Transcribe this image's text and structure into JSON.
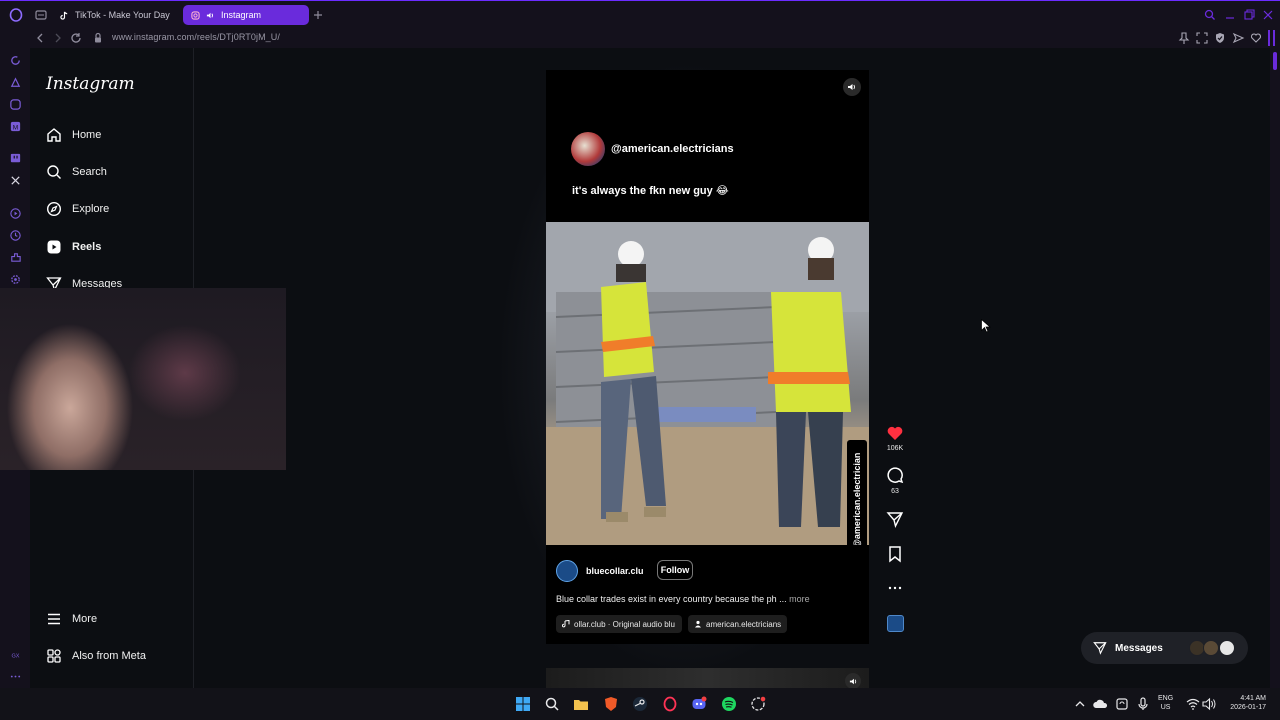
{
  "browser": {
    "tabs": [
      {
        "label": "TikTok - Make Your Day",
        "active": false
      },
      {
        "label": "Instagram",
        "active": true
      }
    ],
    "url": "www.instagram.com/reels/DTj0RT0jM_U/",
    "accent": "#6a2bdc"
  },
  "instagram": {
    "logo": "Instagram",
    "nav": [
      {
        "label": "Home",
        "icon": "home-icon"
      },
      {
        "label": "Search",
        "icon": "search-icon"
      },
      {
        "label": "Explore",
        "icon": "explore-icon"
      },
      {
        "label": "Reels",
        "icon": "reels-icon"
      },
      {
        "label": "Messages",
        "icon": "messages-icon"
      }
    ],
    "nav_bottom": [
      {
        "label": "More",
        "icon": "menu-icon"
      },
      {
        "label": "Also from Meta",
        "icon": "meta-grid-icon"
      }
    ]
  },
  "reel": {
    "overlay_handle": "@american.electricians",
    "overlay_caption": "it's always the fkn new guy 😂",
    "credit_text": "Credit: @american.electrician",
    "author": "bluecollar.clu",
    "follow_label": "Follow",
    "description": "Blue collar trades exist in every country because the ph ...",
    "more_label": "more",
    "audio": "ollar.club · Original audio  blu",
    "tagged_user": "american.electricians",
    "likes": "106K",
    "comments": "63",
    "like_color": "#ff3040"
  },
  "messages_button": {
    "label": "Messages"
  },
  "taskbar": {
    "lang_top": "ENG",
    "lang_bottom": "US",
    "time": "4:41 AM",
    "date": "2026-01-17"
  }
}
